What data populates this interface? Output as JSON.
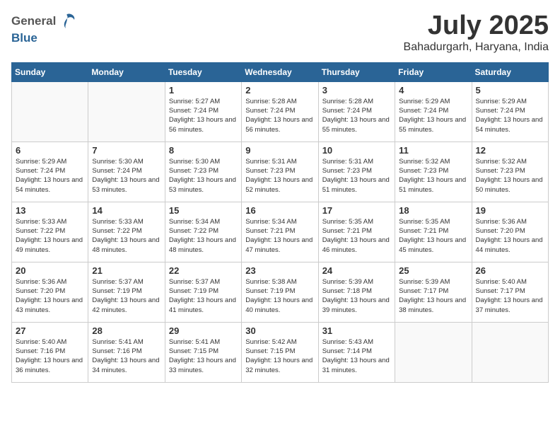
{
  "header": {
    "logo_general": "General",
    "logo_blue": "Blue",
    "month": "July 2025",
    "location": "Bahadurgarh, Haryana, India"
  },
  "weekdays": [
    "Sunday",
    "Monday",
    "Tuesday",
    "Wednesday",
    "Thursday",
    "Friday",
    "Saturday"
  ],
  "weeks": [
    [
      {
        "day": "",
        "info": ""
      },
      {
        "day": "",
        "info": ""
      },
      {
        "day": "1",
        "info": "Sunrise: 5:27 AM\nSunset: 7:24 PM\nDaylight: 13 hours and 56 minutes."
      },
      {
        "day": "2",
        "info": "Sunrise: 5:28 AM\nSunset: 7:24 PM\nDaylight: 13 hours and 56 minutes."
      },
      {
        "day": "3",
        "info": "Sunrise: 5:28 AM\nSunset: 7:24 PM\nDaylight: 13 hours and 55 minutes."
      },
      {
        "day": "4",
        "info": "Sunrise: 5:29 AM\nSunset: 7:24 PM\nDaylight: 13 hours and 55 minutes."
      },
      {
        "day": "5",
        "info": "Sunrise: 5:29 AM\nSunset: 7:24 PM\nDaylight: 13 hours and 54 minutes."
      }
    ],
    [
      {
        "day": "6",
        "info": "Sunrise: 5:29 AM\nSunset: 7:24 PM\nDaylight: 13 hours and 54 minutes."
      },
      {
        "day": "7",
        "info": "Sunrise: 5:30 AM\nSunset: 7:24 PM\nDaylight: 13 hours and 53 minutes."
      },
      {
        "day": "8",
        "info": "Sunrise: 5:30 AM\nSunset: 7:23 PM\nDaylight: 13 hours and 53 minutes."
      },
      {
        "day": "9",
        "info": "Sunrise: 5:31 AM\nSunset: 7:23 PM\nDaylight: 13 hours and 52 minutes."
      },
      {
        "day": "10",
        "info": "Sunrise: 5:31 AM\nSunset: 7:23 PM\nDaylight: 13 hours and 51 minutes."
      },
      {
        "day": "11",
        "info": "Sunrise: 5:32 AM\nSunset: 7:23 PM\nDaylight: 13 hours and 51 minutes."
      },
      {
        "day": "12",
        "info": "Sunrise: 5:32 AM\nSunset: 7:23 PM\nDaylight: 13 hours and 50 minutes."
      }
    ],
    [
      {
        "day": "13",
        "info": "Sunrise: 5:33 AM\nSunset: 7:22 PM\nDaylight: 13 hours and 49 minutes."
      },
      {
        "day": "14",
        "info": "Sunrise: 5:33 AM\nSunset: 7:22 PM\nDaylight: 13 hours and 48 minutes."
      },
      {
        "day": "15",
        "info": "Sunrise: 5:34 AM\nSunset: 7:22 PM\nDaylight: 13 hours and 48 minutes."
      },
      {
        "day": "16",
        "info": "Sunrise: 5:34 AM\nSunset: 7:21 PM\nDaylight: 13 hours and 47 minutes."
      },
      {
        "day": "17",
        "info": "Sunrise: 5:35 AM\nSunset: 7:21 PM\nDaylight: 13 hours and 46 minutes."
      },
      {
        "day": "18",
        "info": "Sunrise: 5:35 AM\nSunset: 7:21 PM\nDaylight: 13 hours and 45 minutes."
      },
      {
        "day": "19",
        "info": "Sunrise: 5:36 AM\nSunset: 7:20 PM\nDaylight: 13 hours and 44 minutes."
      }
    ],
    [
      {
        "day": "20",
        "info": "Sunrise: 5:36 AM\nSunset: 7:20 PM\nDaylight: 13 hours and 43 minutes."
      },
      {
        "day": "21",
        "info": "Sunrise: 5:37 AM\nSunset: 7:19 PM\nDaylight: 13 hours and 42 minutes."
      },
      {
        "day": "22",
        "info": "Sunrise: 5:37 AM\nSunset: 7:19 PM\nDaylight: 13 hours and 41 minutes."
      },
      {
        "day": "23",
        "info": "Sunrise: 5:38 AM\nSunset: 7:19 PM\nDaylight: 13 hours and 40 minutes."
      },
      {
        "day": "24",
        "info": "Sunrise: 5:39 AM\nSunset: 7:18 PM\nDaylight: 13 hours and 39 minutes."
      },
      {
        "day": "25",
        "info": "Sunrise: 5:39 AM\nSunset: 7:17 PM\nDaylight: 13 hours and 38 minutes."
      },
      {
        "day": "26",
        "info": "Sunrise: 5:40 AM\nSunset: 7:17 PM\nDaylight: 13 hours and 37 minutes."
      }
    ],
    [
      {
        "day": "27",
        "info": "Sunrise: 5:40 AM\nSunset: 7:16 PM\nDaylight: 13 hours and 36 minutes."
      },
      {
        "day": "28",
        "info": "Sunrise: 5:41 AM\nSunset: 7:16 PM\nDaylight: 13 hours and 34 minutes."
      },
      {
        "day": "29",
        "info": "Sunrise: 5:41 AM\nSunset: 7:15 PM\nDaylight: 13 hours and 33 minutes."
      },
      {
        "day": "30",
        "info": "Sunrise: 5:42 AM\nSunset: 7:15 PM\nDaylight: 13 hours and 32 minutes."
      },
      {
        "day": "31",
        "info": "Sunrise: 5:43 AM\nSunset: 7:14 PM\nDaylight: 13 hours and 31 minutes."
      },
      {
        "day": "",
        "info": ""
      },
      {
        "day": "",
        "info": ""
      }
    ]
  ]
}
